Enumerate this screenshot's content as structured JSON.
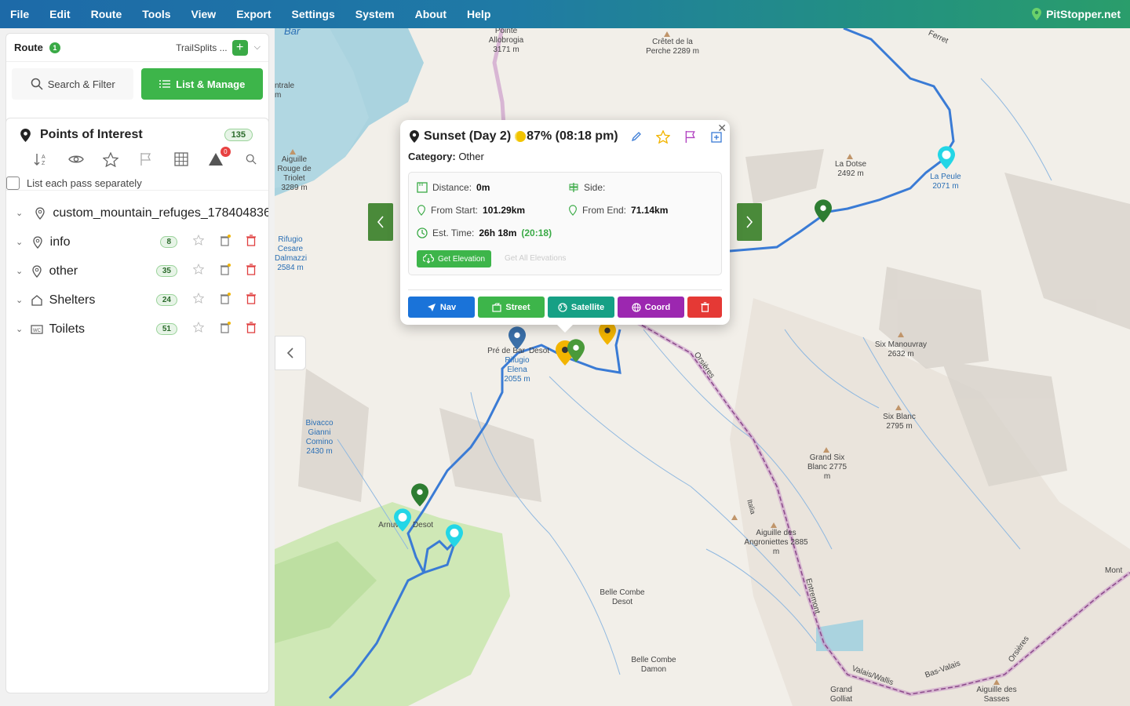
{
  "menu": [
    "File",
    "Edit",
    "Route",
    "Tools",
    "View",
    "Export",
    "Settings",
    "System",
    "About",
    "Help"
  ],
  "brand": "PitStopper.net",
  "route": {
    "label": "Route",
    "count": "1",
    "name": "TrailSplits ..."
  },
  "tabs": {
    "search": "Search & Filter",
    "list": "List & Manage"
  },
  "poi": {
    "title": "Points of Interest",
    "count": "135",
    "warn_badge": "0",
    "list_each_pass": "List each pass separately",
    "layers": [
      {
        "name": "custom_mountain_refuges_178404836",
        "count": ""
      },
      {
        "name": "info",
        "count": "8"
      },
      {
        "name": "other",
        "count": "35"
      },
      {
        "name": "Shelters",
        "count": "24"
      },
      {
        "name": "Toilets",
        "count": "51"
      }
    ]
  },
  "popup": {
    "title": "Sunset (Day 2)",
    "moon": "87% (08:18 pm)",
    "category_label": "Category:",
    "category": "Other",
    "distance_label": "Distance:",
    "distance": "0m",
    "side_label": "Side:",
    "from_start_label": "From Start:",
    "from_start": "101.29km",
    "from_end_label": "From End:",
    "from_end": "71.14km",
    "est_label": "Est. Time:",
    "est": "26h 18m",
    "est_clock": "(20:18)",
    "get_elevation": "Get Elevation",
    "get_all": "Get All Elevations",
    "buttons": {
      "nav": "Nav",
      "street": "Street",
      "satellite": "Satellite",
      "coord": "Coord"
    }
  },
  "map_labels": [
    "Bar",
    "Pointe Allobrogia 3171 m",
    "Crêtet de la Perche 2289 m",
    "Ferret",
    "ntrale m",
    "Aiguille Rouge de Triolet 3289 m",
    "La Dotse 2492 m",
    "La Peule 2071 m",
    "Rifugio Cesare Dalmazzi 2584 m",
    "Six Manouvray 2632 m",
    "Pré de Bar",
    "Desot",
    "Rifugio Elena 2055 m",
    "Orsières",
    "Bivacco Gianni Comino 2430 m",
    "Six Blanc 2795 m",
    "Grand Six Blanc 2775 m",
    "Arnuva",
    "Desot",
    "Aiguille des Angroniettes 2885 m",
    "Italia",
    "Belle Combe Desot",
    "Entremont",
    "Mont",
    "Belle Combe Damon",
    "Valais/Wallis",
    "Bas-Valais",
    "Grand Golliat",
    "Aiguille des Sasses",
    "Orsières"
  ],
  "colors": {
    "accent": "#3db54a",
    "route": "#3a7bd5",
    "border": "#9b5a9b"
  }
}
